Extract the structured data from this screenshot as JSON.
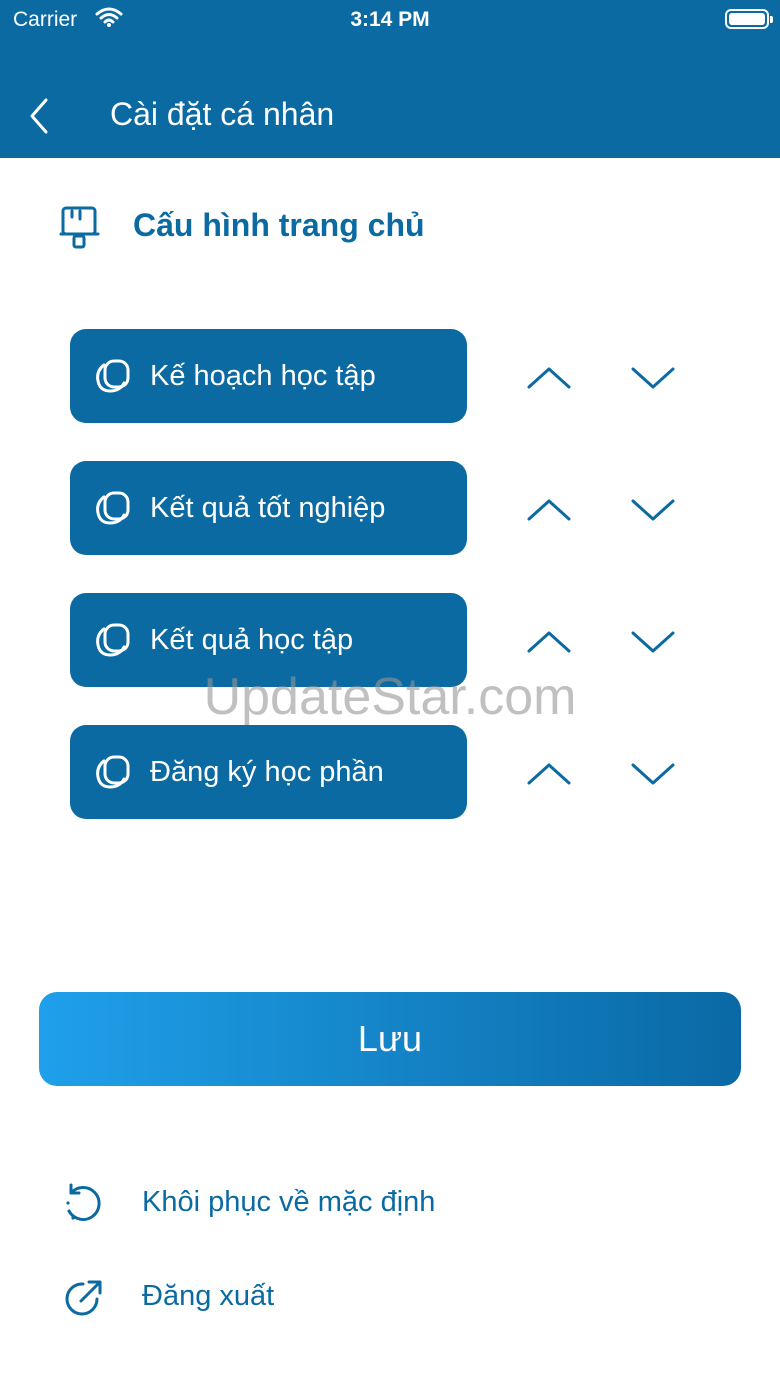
{
  "status_bar": {
    "carrier": "Carrier",
    "time": "3:14 PM"
  },
  "nav": {
    "title": "Cài đặt cá nhân",
    "back_icon": "chevron-left-icon"
  },
  "section": {
    "title": "Cấu hình trang chủ",
    "icon": "monitor-stand-icon"
  },
  "items": [
    {
      "label": "Kế hoạch học tập"
    },
    {
      "label": "Kết quả tốt nghiệp"
    },
    {
      "label": "Kết quả học tập"
    },
    {
      "label": "Đăng ký học phần"
    }
  ],
  "watermark": "UpdateStar.com",
  "save_button": {
    "label": "Lưu"
  },
  "actions": {
    "restore": {
      "label": "Khôi phục về mặc định",
      "icon": "restore-icon"
    },
    "logout": {
      "label": "Đăng xuất",
      "icon": "logout-icon"
    }
  },
  "colors": {
    "primary": "#0b6aa2",
    "gradient_start": "#1fa0ea",
    "gradient_end": "#0a69a5"
  }
}
